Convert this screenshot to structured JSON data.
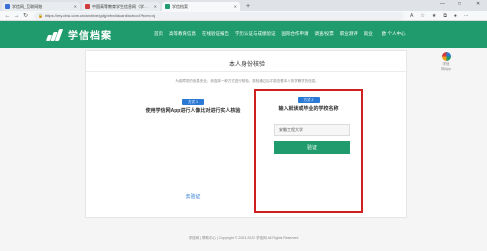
{
  "browser": {
    "tabs": [
      {
        "title": "学信网_互联网账",
        "color": "#3a6fd8",
        "active": false
      },
      {
        "title": "中国高等教育学生信息网（学信）",
        "color": "#d03b3b",
        "active": false
      },
      {
        "title": "学信档案",
        "color": "#1f9b6d",
        "active": true
      }
    ],
    "new_tab": "+",
    "url": "https://my.chsi.com.cn/archive/gdjy/xfxx/idcard/school?from=xj",
    "window_controls": {
      "minimize": "—",
      "restore": "□",
      "close": "✕"
    }
  },
  "header": {
    "logo_text": "学信档案",
    "nav": [
      "首页",
      "高等教育信息",
      "在线验证报告",
      "学历认证与成绩验证",
      "国际合作申请",
      "调查/投票",
      "职业测评",
      "就业",
      "欧 个人中心"
    ]
  },
  "card": {
    "title": "本人身份核验",
    "note": "为保障您的信息安全，请选择一种方式进行核验，核验通过后才能查看本人的学籍学历信息。",
    "option1": {
      "badge": "方式 1",
      "heading": "使用学信网App进行人像比对进行实人核验",
      "link": "去验证"
    },
    "option2": {
      "badge": "方式 2",
      "heading": "输入就读或毕业的学校名称",
      "input_value": "安徽工程大学",
      "button": "验证"
    }
  },
  "float": {
    "label": "学信\n网App"
  },
  "footer": "学信网 | 帮助中心 | Copyright © 2003-2022 学信网 All Rights Reserved",
  "colors": {
    "brand": "#1f9b6d",
    "link": "#2a79d5",
    "highlight": "#d01f1f"
  }
}
